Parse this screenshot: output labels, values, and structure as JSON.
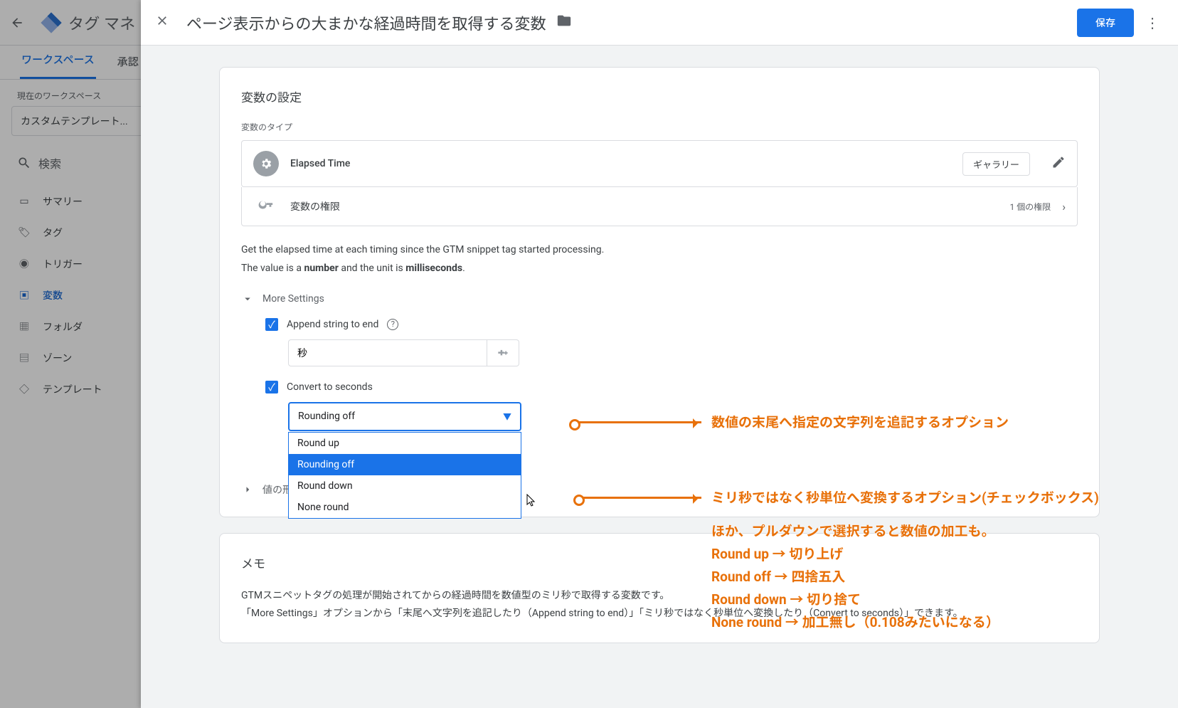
{
  "app": {
    "title": "タグ マネ",
    "back_aria": "back"
  },
  "tabs": {
    "workspace": "ワークスペース",
    "approvals": "承認"
  },
  "sidebar": {
    "ws_label": "現在のワークスペース",
    "ws_value": "カスタムテンプレート...",
    "search_placeholder": "検索",
    "items": [
      {
        "label": "サマリー"
      },
      {
        "label": "タグ"
      },
      {
        "label": "トリガー"
      },
      {
        "label": "変数"
      },
      {
        "label": "フォルダ"
      },
      {
        "label": "ゾーン"
      },
      {
        "label": "テンプレート"
      }
    ]
  },
  "drawer": {
    "title": "ページ表示からの大まかな経過時間を取得する変数",
    "save": "保存"
  },
  "config": {
    "heading": "変数の設定",
    "type_label": "変数のタイプ",
    "type_value": "Elapsed Time",
    "gallery_btn": "ギャラリー",
    "perm_label": "変数の権限",
    "perm_count": "1 個の権限",
    "desc_line1_a": "Get the elapsed time at each timing since the GTM snippet tag started processing.",
    "desc_line2_a": "The value is a ",
    "desc_line2_b": "number",
    "desc_line2_c": " and the unit is ",
    "desc_line2_d": "milliseconds",
    "desc_line2_e": ".",
    "more_settings": "More Settings",
    "append_label": "Append string to end",
    "append_value": "秒",
    "convert_label": "Convert to seconds",
    "rounding_selected": "Rounding off",
    "rounding_options": [
      "Round up",
      "Rounding off",
      "Round down",
      "None round"
    ],
    "value_format": "値の形"
  },
  "memo": {
    "heading": "メモ",
    "l1": "GTMスニペットタグの処理が開始されてからの経過時間を数値型のミリ秒で取得する変数です。",
    "l2": "「More Settings」オプションから「末尾へ文字列を追記したり（Append string to end）」「ミリ秒ではなく秒単位へ変換したり（Convert to seconds）」できます。"
  },
  "annotations": {
    "a1": "数値の末尾へ指定の文字列を追記するオプション",
    "a2": "ミリ秒ではなく秒単位へ変換するオプション(チェックボックス)",
    "a3": "ほか、プルダウンで選択すると数値の加工も。",
    "a4": "Round up → 切り上げ",
    "a5": "Round off → 四捨五入",
    "a6": "Round down → 切り捨て",
    "a7": "None round → 加工無し（0.108みたいになる）"
  }
}
